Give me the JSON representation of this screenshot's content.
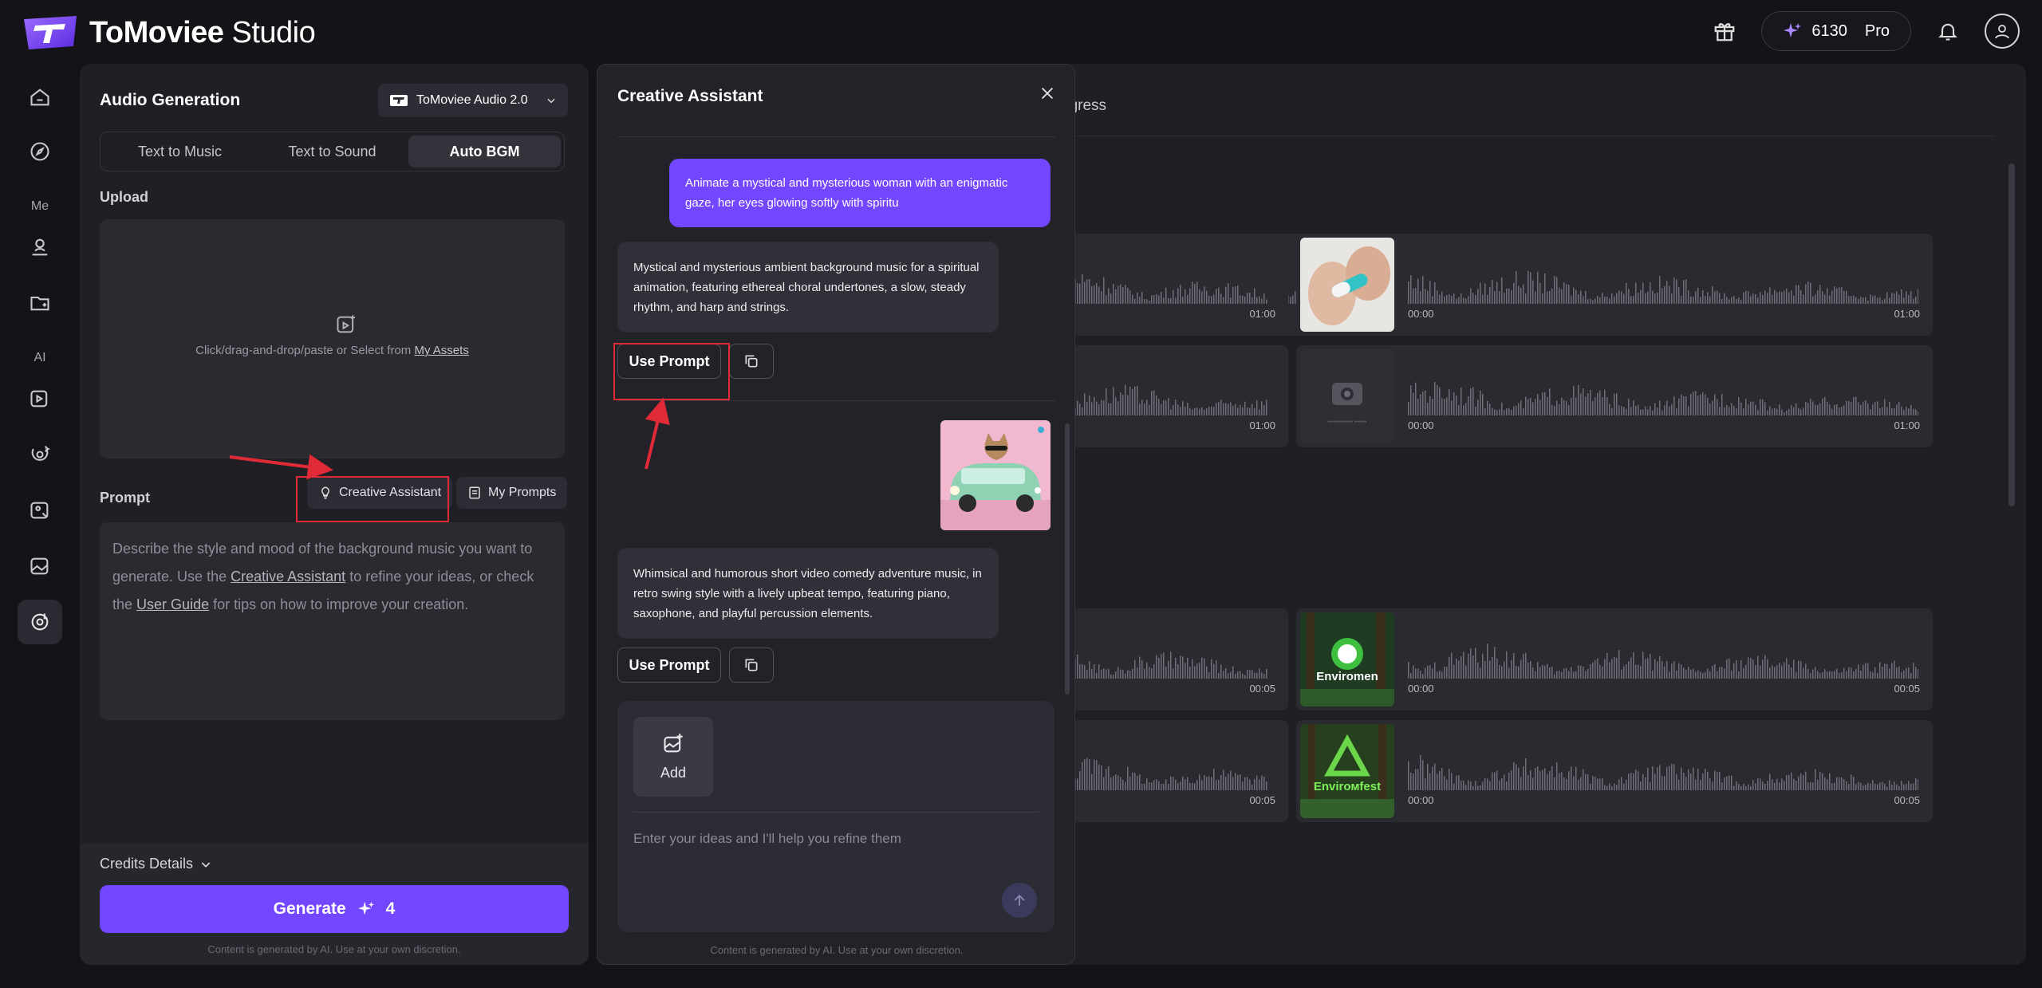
{
  "app": {
    "brand": "ToMoviee",
    "brand_suffix": "Studio"
  },
  "header": {
    "credits": "6130",
    "plan": "Pro"
  },
  "sidebar": {
    "me_label": "Me",
    "ai_label": "AI"
  },
  "left_panel": {
    "title": "Audio Generation",
    "model": "ToMoviee Audio 2.0",
    "tabs": [
      {
        "label": "Text to Music",
        "active": false
      },
      {
        "label": "Text to Sound",
        "active": false
      },
      {
        "label": "Auto BGM",
        "active": true
      }
    ],
    "upload_label": "Upload",
    "upload_text": "Click/drag-and-drop/paste or Select from",
    "upload_link": "My Assets",
    "prompt_label": "Prompt",
    "creative_assistant_btn": "Creative Assistant",
    "my_prompts_btn": "My Prompts",
    "prompt_placeholder_1": "Describe the style and mood of the background music you want to generate. Use the",
    "prompt_link_1": "Creative Assistant",
    "prompt_placeholder_2": "to refine your ideas, or check the",
    "prompt_link_2": "User Guide",
    "prompt_placeholder_3": "for tips on how to improve your creation.",
    "credits_details": "Credits Details",
    "generate_label": "Generate",
    "generate_cost": "4",
    "disclaimer": "Content is generated by AI. Use at your own discretion."
  },
  "assistant": {
    "title": "Creative Assistant",
    "user_message": "Animate a mystical and mysterious woman with an enigmatic gaze, her eyes glowing softly with spiritu",
    "ai_reply_1": "Mystical and mysterious ambient background music for a spiritual animation, featuring ethereal choral undertones, a slow, steady rhythm, and harp and strings.",
    "ai_reply_2": "Whimsical and humorous short video comedy adventure music, in retro swing style with a lively upbeat tempo, featuring piano, saxophone, and playful percussion elements.",
    "use_prompt": "Use Prompt",
    "add_label": "Add",
    "input_placeholder": "Enter your ideas and I'll help you refine them",
    "disclaimer": "Content is generated by AI. Use at your own discretion."
  },
  "results": {
    "header_text": "ogress",
    "cards": [
      {
        "start": "",
        "end": "01:00"
      },
      {
        "start": "00:00",
        "end": "01:00",
        "thumb": "pill"
      },
      {
        "start": "",
        "end": "01:00"
      },
      {
        "start": "00:00",
        "end": "01:00",
        "thumb": "camera",
        "thumb_text": "**********  *****"
      },
      {
        "start": "",
        "end": "00:05"
      },
      {
        "start": "00:00",
        "end": "00:05",
        "thumb": "forest",
        "thumb_text": "Enviromen"
      },
      {
        "start": "",
        "end": "00:05"
      },
      {
        "start": "00:00",
        "end": "00:05",
        "thumb": "forest",
        "thumb_text": "Envirомfest"
      }
    ]
  },
  "colors": {
    "accent": "#7346ff",
    "highlight": "#e02a37",
    "panel": "#1f1f25"
  }
}
